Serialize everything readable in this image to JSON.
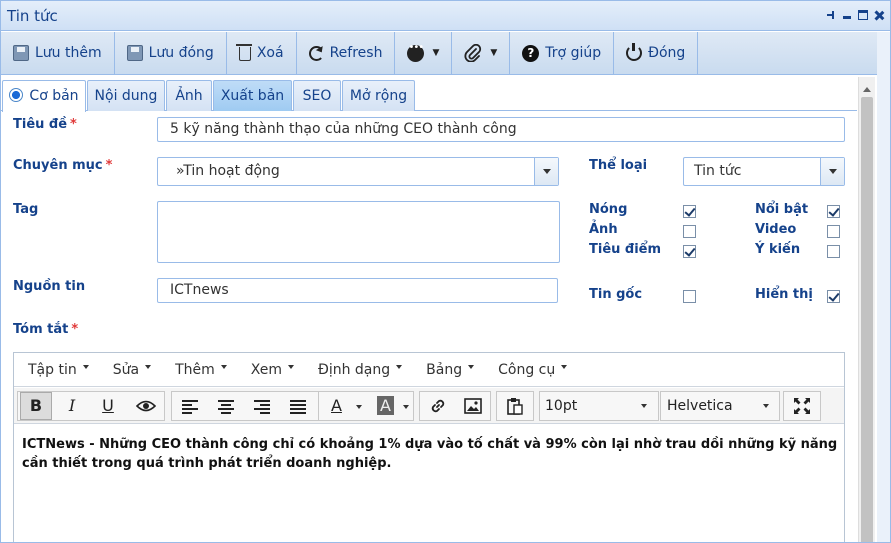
{
  "window": {
    "title": "Tin tức"
  },
  "toolbar": {
    "save_add": "Lưu thêm",
    "save_close": "Lưu đóng",
    "delete": "Xoá",
    "refresh": "Refresh",
    "help": "Trợ giúp",
    "close": "Đóng"
  },
  "tabs": [
    "Cơ bản",
    "Nội dung",
    "Ảnh",
    "Xuất bản",
    "SEO",
    "Mở rộng"
  ],
  "form": {
    "title_label": "Tiêu đề",
    "title_value": "5 kỹ năng thành thạo của những CEO thành công",
    "category_label": "Chuyên mục",
    "category_value": "»Tin hoạt động",
    "type_label": "Thể loại",
    "type_value": "Tin tức",
    "tag_label": "Tag",
    "tag_value": "",
    "source_label": "Nguồn tin",
    "source_value": "ICTnews",
    "summary_label": "Tóm tắt",
    "required_mark": "*",
    "flags": [
      {
        "label": "Nóng",
        "checked": true
      },
      {
        "label": "Nổi bật",
        "checked": true
      },
      {
        "label": "Ảnh",
        "checked": false
      },
      {
        "label": "Video",
        "checked": false
      },
      {
        "label": "Tiêu điểm",
        "checked": true
      },
      {
        "label": "Ý kiến",
        "checked": false
      },
      {
        "label": "Tin gốc",
        "checked": false
      },
      {
        "label": "Hiển thị",
        "checked": true
      }
    ]
  },
  "editor": {
    "menus": [
      "Tập tin",
      "Sửa",
      "Thêm",
      "Xem",
      "Định dạng",
      "Bảng",
      "Công cụ"
    ],
    "buttons": {
      "bold": "B",
      "italic": "I",
      "underline": "U",
      "text_color": "A",
      "bg_color": "A"
    },
    "font_size": "10pt",
    "font_family": "Helvetica",
    "content": "ICTNews - Những CEO thành công chỉ có khoảng 1% dựa vào tố chất và 99% còn lại nhờ trau dồi những kỹ năng cần thiết trong quá trình phát triển doanh nghiệp."
  },
  "colors": {
    "accent": "#15428b",
    "border": "#99bbe8",
    "required": "#e03a3a"
  }
}
